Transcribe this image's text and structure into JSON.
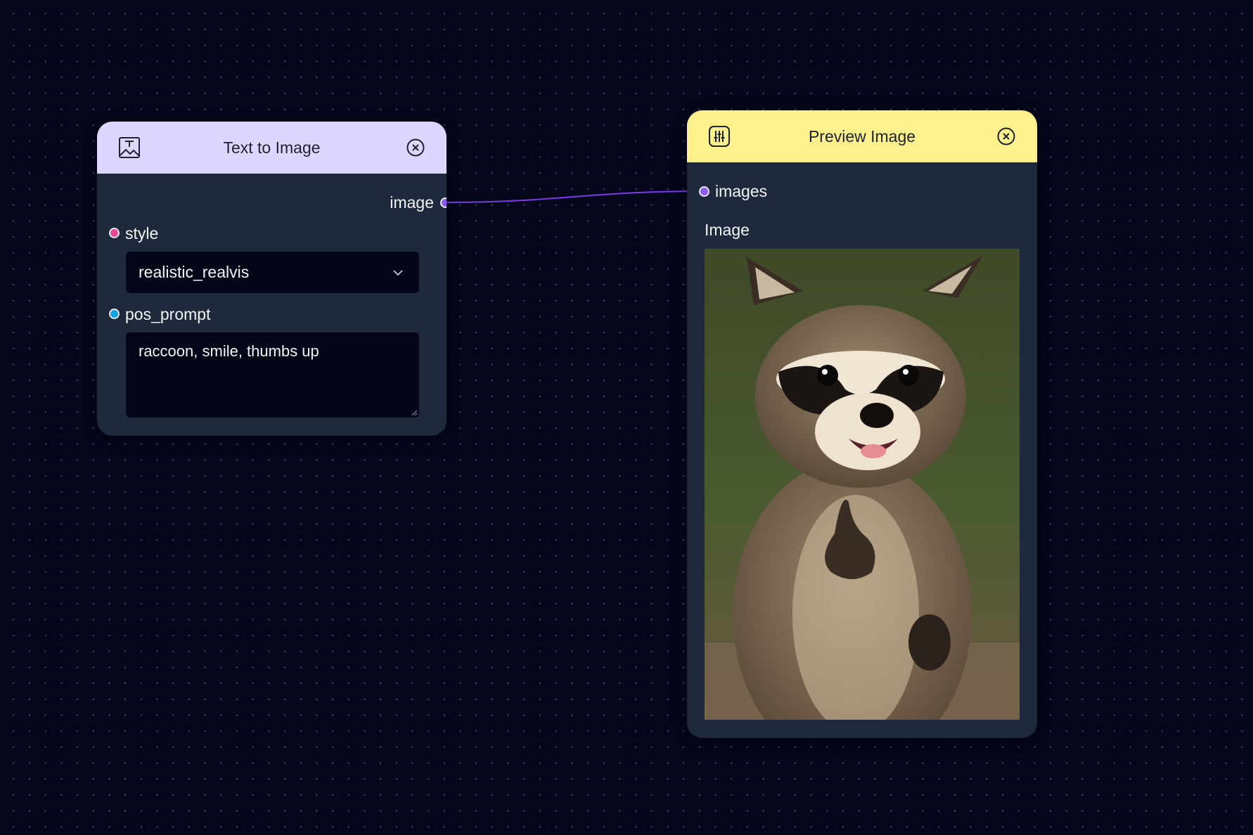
{
  "nodes": {
    "text_to_image": {
      "title": "Text to Image",
      "header_color": "#ddd6fe",
      "output_label": "image",
      "style_label": "style",
      "style_value": "realistic_realvis",
      "prompt_label": "pos_prompt",
      "prompt_value": "raccoon, smile, thumbs up",
      "icons": {
        "header": "image-text-icon",
        "close": "close-circle-icon",
        "dropdown": "chevron-down-icon"
      }
    },
    "preview_image": {
      "title": "Preview Image",
      "header_color": "#fef08a",
      "input_label": "images",
      "image_label": "Image",
      "icons": {
        "header": "sliders-icon",
        "close": "close-circle-icon"
      }
    }
  },
  "colors": {
    "canvas": "#04061a",
    "node_body": "#1e293b",
    "edge": "#7c3aed",
    "port_image": "#8b5cf6",
    "port_style": "#ec4899",
    "port_prompt": "#0ea5e9"
  }
}
